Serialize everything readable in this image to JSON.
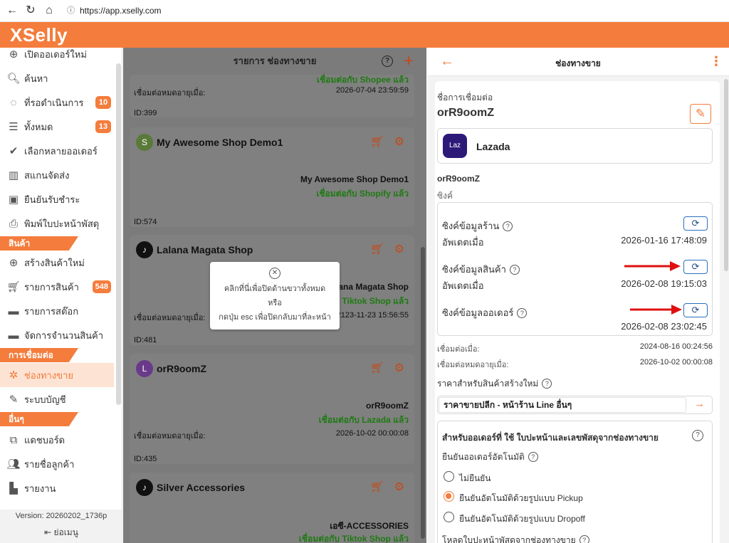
{
  "browser": {
    "url": "https://app.xselly.com"
  },
  "app": {
    "logo": "XSelly",
    "accent": "#f47c3c"
  },
  "sidebar": {
    "items": [
      {
        "label": "เปิดออเดอร์ใหม่",
        "icon": "plus-circle-icon"
      },
      {
        "label": "ค้นหา",
        "icon": "search-icon"
      },
      {
        "label": "ที่รอดำเนินการ",
        "icon": "pending-icon",
        "badge": "10"
      },
      {
        "label": "ทั้งหมด",
        "icon": "list-icon",
        "badge": "13"
      },
      {
        "label": "เลือกหลายออเดอร์",
        "icon": "check-multiple-icon"
      },
      {
        "label": "สแกนจัดส่ง",
        "icon": "barcode-icon"
      },
      {
        "label": "ยืนยันรับชำระ",
        "icon": "cash-icon"
      },
      {
        "label": "พิมพ์ใบปะหน้าพัสดุ",
        "icon": "printer-icon"
      }
    ],
    "section_products": "สินค้า",
    "product_items": [
      {
        "label": "สร้างสินค้าใหม่",
        "icon": "plus-circle-icon"
      },
      {
        "label": "รายการสินค้า",
        "icon": "cart-icon",
        "badge": "548"
      },
      {
        "label": "รายการสต๊อก",
        "icon": "stock-icon"
      },
      {
        "label": "จัดการจำนวนสินค้า",
        "icon": "boxes-icon"
      }
    ],
    "section_connections": "การเชื่อมต่อ",
    "connection_items": [
      {
        "label": "ช่องทางขาย",
        "icon": "channels-icon"
      },
      {
        "label": "ระบบบัญชี",
        "icon": "accounting-icon"
      }
    ],
    "section_others": "อื่นๆ",
    "other_items": [
      {
        "label": "แดชบอร์ด",
        "icon": "dashboard-icon"
      },
      {
        "label": "รายชื่อลูกค้า",
        "icon": "customers-icon"
      },
      {
        "label": "รายงาน",
        "icon": "report-icon"
      }
    ],
    "version": "Version: 20260202_1736p",
    "collapse": "ย่อเมนู"
  },
  "middle": {
    "title": "รายการ ช่องทางขาย",
    "cards": [
      {
        "top_text": "เชื่อมต่อกับ Shopee แล้ว",
        "expire_label": "เชื่อมต่อหมดอายุเมื่อ:",
        "expire": "2026-07-04 23:59:59",
        "id": "ID:399"
      },
      {
        "name": "My Awesome Shop Demo1",
        "shop": "My Awesome Shop Demo1",
        "status": "เชื่อมต่อกับ Shopify แล้ว",
        "id": "ID:574"
      },
      {
        "name": "Lalana Magata Shop",
        "shop": "ana Magata Shop",
        "status": "Tiktok Shop แล้ว",
        "expire_label": "เชื่อมต่อหมดอายุเมื่อ:",
        "expire": "2123-11-23 15:56:55",
        "id": "ID:481"
      },
      {
        "name": "orR9oomZ",
        "shop": "orR9oomZ",
        "status": "เชื่อมต่อกับ Lazada แล้ว",
        "expire_label": "เชื่อมต่อหมดอายุเมื่อ:",
        "expire": "2026-10-02 00:00:08",
        "id": "ID:435"
      },
      {
        "name": "Silver Accessories",
        "shop": "เอซี-ACCESSORIES",
        "status": "เชื่อมต่อกับ Tiktok Shop แล้ว"
      }
    ],
    "popup": {
      "line1": "คลิกที่นี่เพื่อปิดด้านขวาทั้งหมด",
      "line2": "หรือ",
      "line3": "กดปุ่ม esc เพื่อปิดกลับมาที่ละหน้า"
    }
  },
  "detail": {
    "title": "ช่องทางขาย",
    "conn_name_label": "ชื่อการเชื่อมต่อ",
    "conn_name": "orR9oomZ",
    "channel": "Lazada",
    "shop_name": "orR9oomZ",
    "sync_label": "ซิงค์",
    "sync_shop": "ซิงค์ข้อมูลร้าน",
    "updated_label": "อัพเดตเมื่อ",
    "sync_shop_time": "2026-01-16 17:48:09",
    "sync_product": "ซิงค์ข้อมูลสินค้า",
    "sync_product_time": "2026-02-08 19:15:03",
    "sync_order": "ซิงค์ข้อมูลออเดอร์",
    "sync_order_time": "2026-02-08 23:02:45",
    "connected_label": "เชื่อมต่อเมื่อ:",
    "connected": "2024-08-16 00:24:56",
    "expire_label": "เชื่อมต่อหมดอายุเมื่อ:",
    "expire": "2026-10-02 00:00:08",
    "price_label": "ราคาสำหรับสินค้าสร้างใหม่",
    "price_value": "ราคาขายปลีก - หน้าร้าน Line อื่นๆ",
    "order_section": "สำหรับออเดอร์ที่ ใช้ ใบปะหน้าและเลขพัสดุจากช่องทางขาย",
    "auto_confirm_label": "ยืนยันออเดอร์อัตโนมัติ",
    "options": [
      "ไม่ยืนยัน",
      "ยืนยันอัตโนมัติด้วยรูปแบบ Pickup",
      "ยืนยันอัตโนมัติด้วยรูปแบบ Dropoff"
    ],
    "selected_option": "ยืนยันอัตโนมัติด้วยรูปแบบ Pickup",
    "download_label": "โหลดใบปะหน้าพัสดุจากช่องทางขาย"
  }
}
